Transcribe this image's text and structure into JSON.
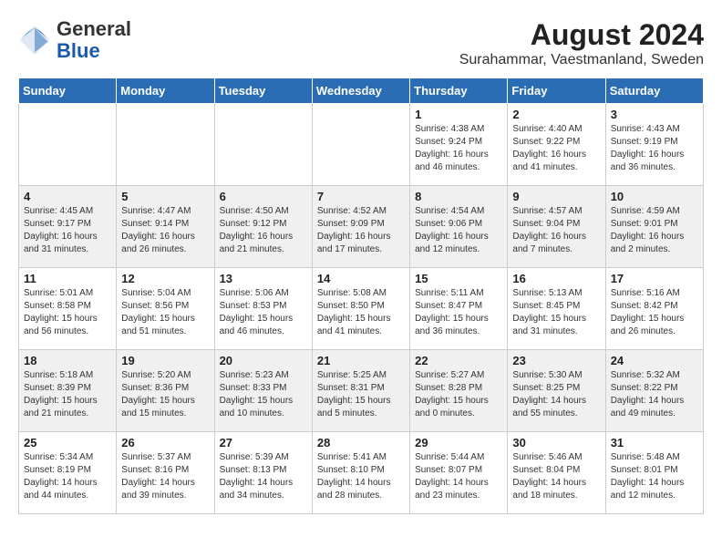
{
  "logo": {
    "general": "General",
    "blue": "Blue"
  },
  "title": "August 2024",
  "subtitle": "Surahammar, Vaestmanland, Sweden",
  "days_of_week": [
    "Sunday",
    "Monday",
    "Tuesday",
    "Wednesday",
    "Thursday",
    "Friday",
    "Saturday"
  ],
  "weeks": [
    [
      {
        "day": "",
        "info": ""
      },
      {
        "day": "",
        "info": ""
      },
      {
        "day": "",
        "info": ""
      },
      {
        "day": "",
        "info": ""
      },
      {
        "day": "1",
        "info": "Sunrise: 4:38 AM\nSunset: 9:24 PM\nDaylight: 16 hours\nand 46 minutes."
      },
      {
        "day": "2",
        "info": "Sunrise: 4:40 AM\nSunset: 9:22 PM\nDaylight: 16 hours\nand 41 minutes."
      },
      {
        "day": "3",
        "info": "Sunrise: 4:43 AM\nSunset: 9:19 PM\nDaylight: 16 hours\nand 36 minutes."
      }
    ],
    [
      {
        "day": "4",
        "info": "Sunrise: 4:45 AM\nSunset: 9:17 PM\nDaylight: 16 hours\nand 31 minutes."
      },
      {
        "day": "5",
        "info": "Sunrise: 4:47 AM\nSunset: 9:14 PM\nDaylight: 16 hours\nand 26 minutes."
      },
      {
        "day": "6",
        "info": "Sunrise: 4:50 AM\nSunset: 9:12 PM\nDaylight: 16 hours\nand 21 minutes."
      },
      {
        "day": "7",
        "info": "Sunrise: 4:52 AM\nSunset: 9:09 PM\nDaylight: 16 hours\nand 17 minutes."
      },
      {
        "day": "8",
        "info": "Sunrise: 4:54 AM\nSunset: 9:06 PM\nDaylight: 16 hours\nand 12 minutes."
      },
      {
        "day": "9",
        "info": "Sunrise: 4:57 AM\nSunset: 9:04 PM\nDaylight: 16 hours\nand 7 minutes."
      },
      {
        "day": "10",
        "info": "Sunrise: 4:59 AM\nSunset: 9:01 PM\nDaylight: 16 hours\nand 2 minutes."
      }
    ],
    [
      {
        "day": "11",
        "info": "Sunrise: 5:01 AM\nSunset: 8:58 PM\nDaylight: 15 hours\nand 56 minutes."
      },
      {
        "day": "12",
        "info": "Sunrise: 5:04 AM\nSunset: 8:56 PM\nDaylight: 15 hours\nand 51 minutes."
      },
      {
        "day": "13",
        "info": "Sunrise: 5:06 AM\nSunset: 8:53 PM\nDaylight: 15 hours\nand 46 minutes."
      },
      {
        "day": "14",
        "info": "Sunrise: 5:08 AM\nSunset: 8:50 PM\nDaylight: 15 hours\nand 41 minutes."
      },
      {
        "day": "15",
        "info": "Sunrise: 5:11 AM\nSunset: 8:47 PM\nDaylight: 15 hours\nand 36 minutes."
      },
      {
        "day": "16",
        "info": "Sunrise: 5:13 AM\nSunset: 8:45 PM\nDaylight: 15 hours\nand 31 minutes."
      },
      {
        "day": "17",
        "info": "Sunrise: 5:16 AM\nSunset: 8:42 PM\nDaylight: 15 hours\nand 26 minutes."
      }
    ],
    [
      {
        "day": "18",
        "info": "Sunrise: 5:18 AM\nSunset: 8:39 PM\nDaylight: 15 hours\nand 21 minutes."
      },
      {
        "day": "19",
        "info": "Sunrise: 5:20 AM\nSunset: 8:36 PM\nDaylight: 15 hours\nand 15 minutes."
      },
      {
        "day": "20",
        "info": "Sunrise: 5:23 AM\nSunset: 8:33 PM\nDaylight: 15 hours\nand 10 minutes."
      },
      {
        "day": "21",
        "info": "Sunrise: 5:25 AM\nSunset: 8:31 PM\nDaylight: 15 hours\nand 5 minutes."
      },
      {
        "day": "22",
        "info": "Sunrise: 5:27 AM\nSunset: 8:28 PM\nDaylight: 15 hours\nand 0 minutes."
      },
      {
        "day": "23",
        "info": "Sunrise: 5:30 AM\nSunset: 8:25 PM\nDaylight: 14 hours\nand 55 minutes."
      },
      {
        "day": "24",
        "info": "Sunrise: 5:32 AM\nSunset: 8:22 PM\nDaylight: 14 hours\nand 49 minutes."
      }
    ],
    [
      {
        "day": "25",
        "info": "Sunrise: 5:34 AM\nSunset: 8:19 PM\nDaylight: 14 hours\nand 44 minutes."
      },
      {
        "day": "26",
        "info": "Sunrise: 5:37 AM\nSunset: 8:16 PM\nDaylight: 14 hours\nand 39 minutes."
      },
      {
        "day": "27",
        "info": "Sunrise: 5:39 AM\nSunset: 8:13 PM\nDaylight: 14 hours\nand 34 minutes."
      },
      {
        "day": "28",
        "info": "Sunrise: 5:41 AM\nSunset: 8:10 PM\nDaylight: 14 hours\nand 28 minutes."
      },
      {
        "day": "29",
        "info": "Sunrise: 5:44 AM\nSunset: 8:07 PM\nDaylight: 14 hours\nand 23 minutes."
      },
      {
        "day": "30",
        "info": "Sunrise: 5:46 AM\nSunset: 8:04 PM\nDaylight: 14 hours\nand 18 minutes."
      },
      {
        "day": "31",
        "info": "Sunrise: 5:48 AM\nSunset: 8:01 PM\nDaylight: 14 hours\nand 12 minutes."
      }
    ]
  ]
}
